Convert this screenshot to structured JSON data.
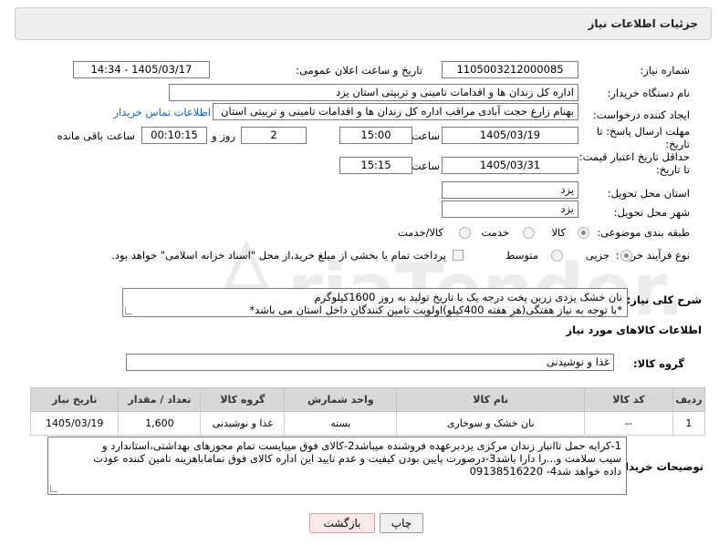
{
  "header": {
    "title": "جزئیات اطلاعات نیاز"
  },
  "fields": {
    "need_number_label": "شماره نیاز:",
    "need_number": "1105003212000085",
    "announce_label": "تاریخ و ساعت اعلان عمومی:",
    "announce_value": "1405/03/17 - 14:34",
    "buyer_org_label": "نام دستگاه خریدار:",
    "buyer_org": "اداره کل زندان ها و اقدامات تامینی و تربیتی استان یزد",
    "requester_label": "ایجاد کننده درخواست:",
    "requester": "بهنام زارع حجت آبادی مراقب اداره کل زندان ها و اقدامات تامینی و تربیتی استان",
    "contact_link": "اطلاعات تماس خریدار",
    "deadline_label": "مهلت ارسال پاسخ: تا تاریخ:",
    "deadline_date": "1405/03/19",
    "time_label": "ساعت",
    "deadline_time": "15:00",
    "days_value": "2",
    "days_label": "روز و",
    "remaining_time": "00:10:15",
    "remaining_label": "ساعت باقی مانده",
    "price_validity_label": "حداقل تاریخ اعتبار قیمت: تا تاریخ:",
    "price_validity_date": "1405/03/31",
    "price_validity_time": "15:15",
    "province_label": "استان محل تحویل:",
    "province": "یزد",
    "city_label": "شهر محل تحویل:",
    "city": "یزد",
    "category_label": "طبقه بندی موضوعی:",
    "category_options": [
      "کالا",
      "خدمت",
      "کالا/خدمت"
    ],
    "process_label": "نوع فرآیند خرید :",
    "process_options": [
      "جزیی",
      "متوسط"
    ],
    "payment_note": "پرداخت تمام یا بخشی از مبلغ خرید،از محل \"اسناد خزانه اسلامی\" خواهد بود."
  },
  "description": {
    "label": "شرح کلی نیاز:",
    "line1": "نان خشک یزدی زرین پخت درجه یک با تاریخ تولید به روز 1600کیلوگرم",
    "line2": "*با توجه به نیاز هفتگی(هر هفته 400کیلو)اولویت تامین کنندگان داخل استان می باشد*"
  },
  "goods": {
    "title": "اطلاعات کالاهای مورد نیاز",
    "group_label": "گروه کالا:",
    "group_value": "غذا و نوشیدنی",
    "columns": [
      "ردیف",
      "کد کالا",
      "نام کالا",
      "واحد شمارش",
      "گروه کالا",
      "تعداد / مقدار",
      "تاریخ نیاز"
    ],
    "rows": [
      [
        "1",
        "--",
        "نان خشک و سوخاری",
        "بسته",
        "غذا و نوشیدنی",
        "1,600",
        "1405/03/19"
      ]
    ]
  },
  "buyer_notes": {
    "label": "توضیحات خریدار:",
    "line1": "1-کرایه حمل تاانبار زندان مرکزی یزدبرعهده فروشنده میباشد2-کالای فوق میبایست تمام مجوزهای بهداشتی،استاندارد و",
    "line2": "سیب سلامت و...را دارا باشد3-درصورت پایین بودن کیفیت و عدم تایید این اداره کالای فوق تماماباهزینه تامین کننده عودت",
    "line3": "داده خواهد شد4- 09138516220"
  },
  "buttons": {
    "print": "چاپ",
    "back": "بازگشت"
  },
  "watermark": "AriaTender.net",
  "colors": {
    "link": "#1d5fb8",
    "header_bg": "#eeeeee",
    "table_header_bg": "#d8d8d8",
    "back_button_bg": "#fbe9ea"
  }
}
